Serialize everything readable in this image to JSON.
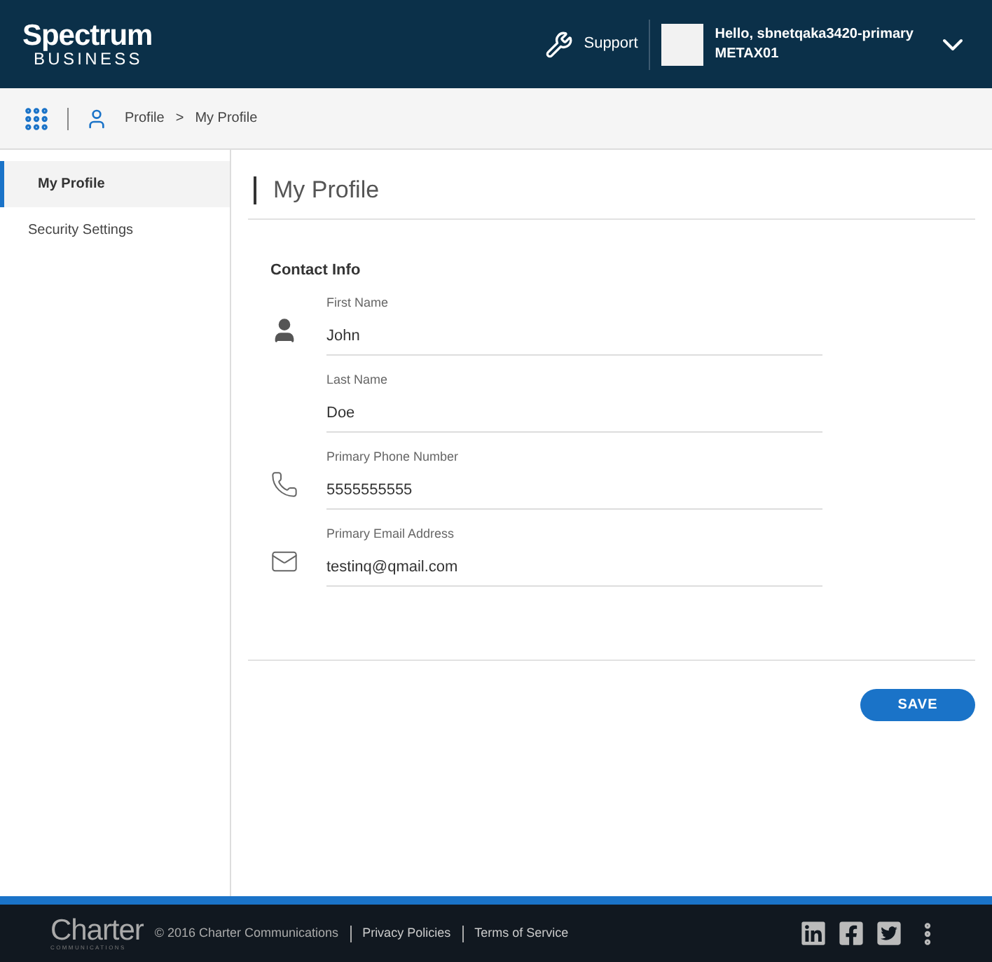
{
  "header": {
    "logo": {
      "name": "Spectrum",
      "sub": "BUSINESS"
    },
    "support": "Support",
    "greeting": "Hello, sbnetqaka3420-primary",
    "account": "METAX01"
  },
  "breadcrumb": [
    "Profile",
    ">",
    "My Profile"
  ],
  "sidebar": {
    "items": [
      {
        "label": "My Profile",
        "selected": true
      },
      {
        "label": "Security Settings",
        "selected": false
      }
    ]
  },
  "page_title": "My Profile",
  "section_title": "Contact Info",
  "fields": [
    {
      "label": "First Name",
      "value": "John",
      "kind": "first_name"
    },
    {
      "label": "Last Name",
      "value": "Doe",
      "kind": "last_name"
    },
    {
      "label": "Primary Phone Number",
      "value": "5555555555",
      "kind": "phone"
    },
    {
      "label": "Primary Email Address",
      "value": "testinq@qmail.com",
      "kind": "email"
    }
  ],
  "save_button": "SAVE",
  "footer": {
    "logo": {
      "name": "Charter",
      "sub": "COMMUNICATIONS"
    },
    "links": [
      {
        "label": "© 2016 Charter Communications",
        "kind": "text"
      },
      {
        "label": "Privacy Policies",
        "kind": "link"
      },
      {
        "label": "Terms of Service",
        "kind": "link"
      }
    ]
  }
}
